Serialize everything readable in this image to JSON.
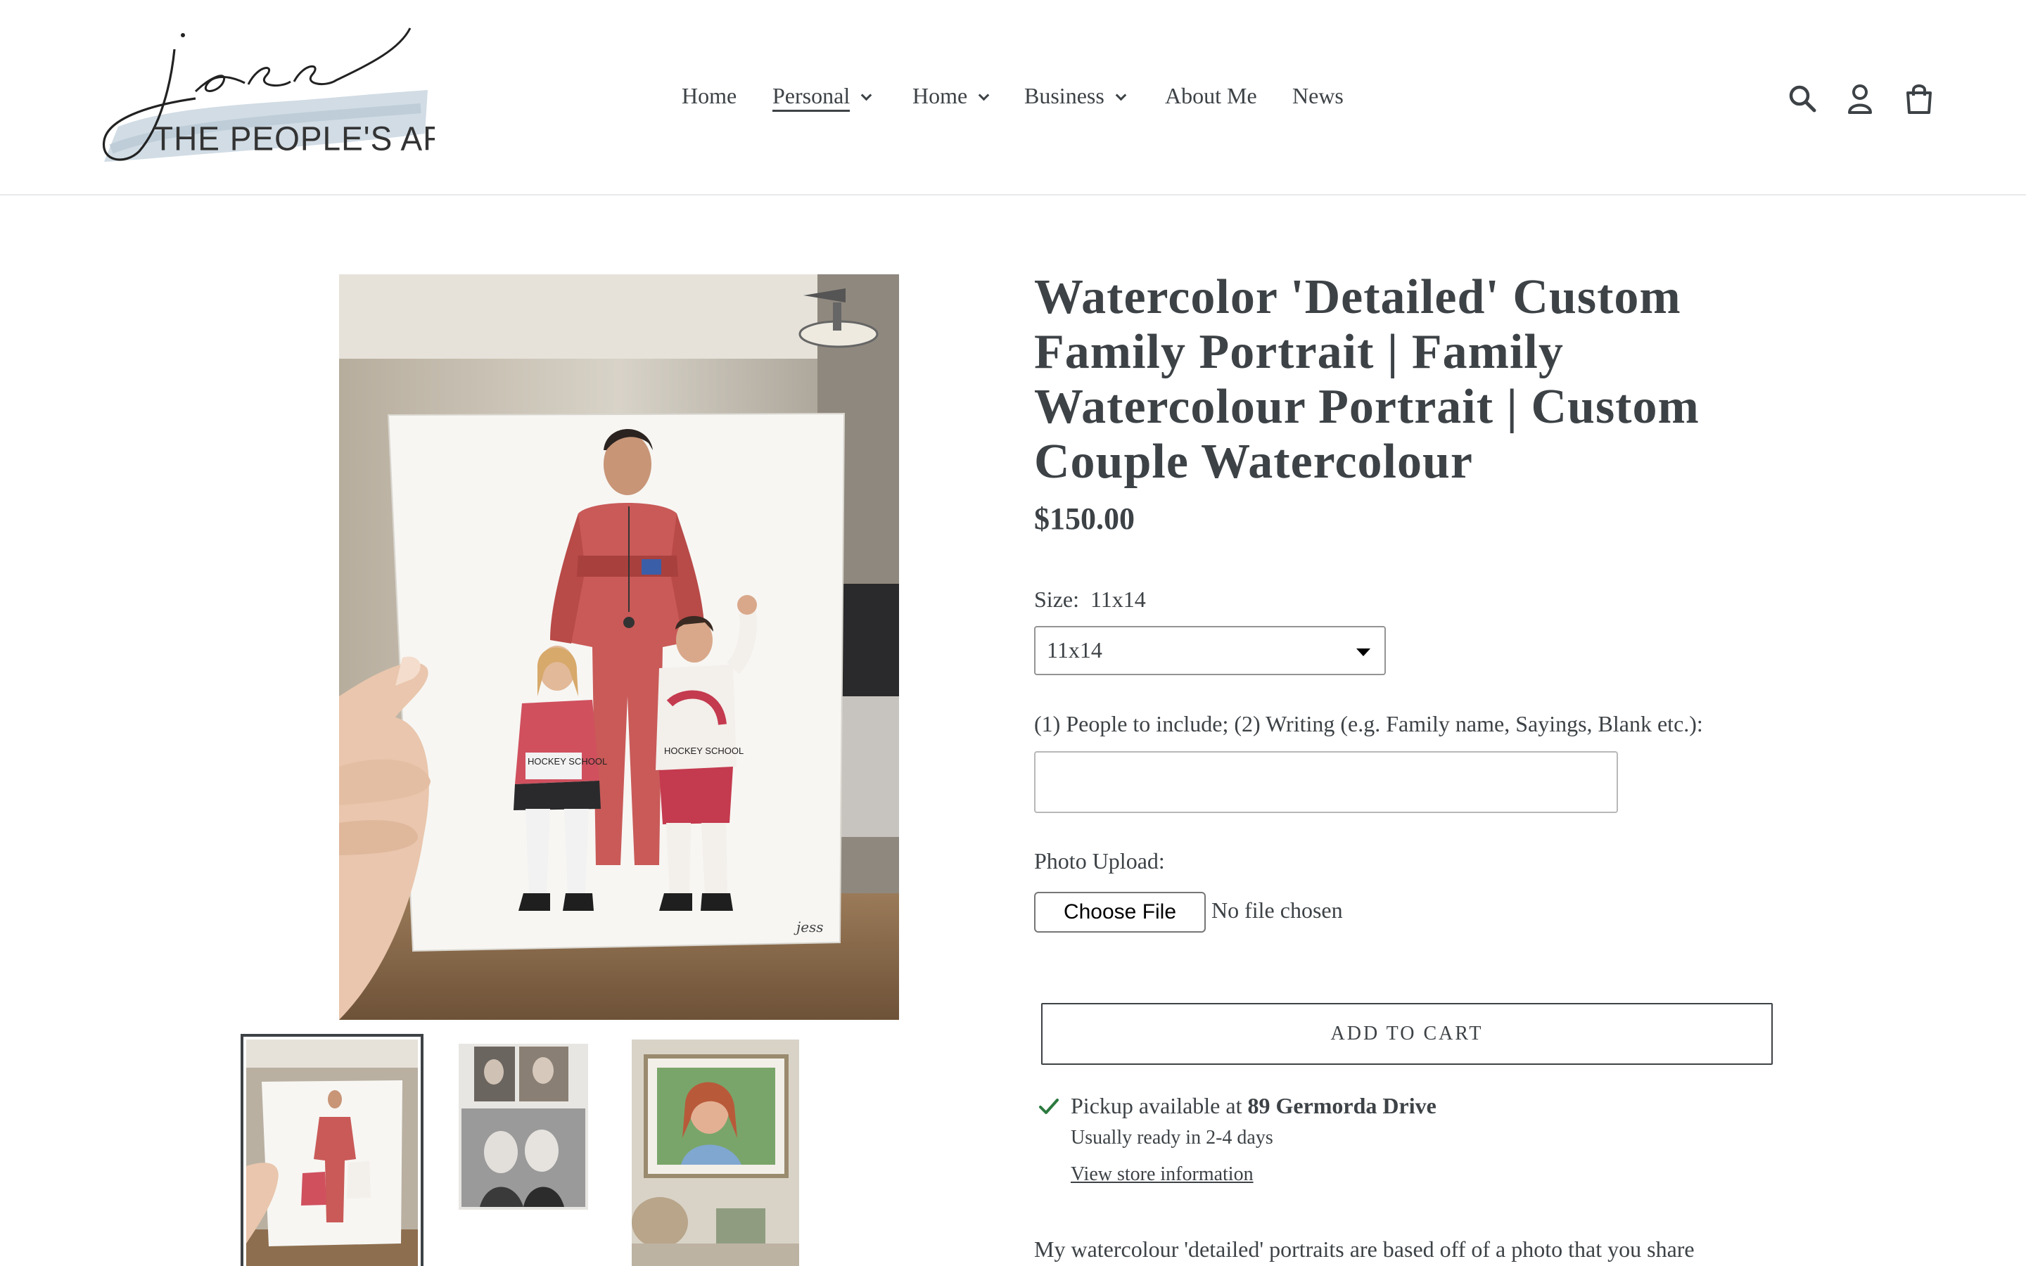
{
  "header": {
    "logo_script": "jess",
    "logo_tagline": "THE PEOPLE'S ARTIST",
    "nav": [
      {
        "label": "Home"
      },
      {
        "label": "Personal"
      },
      {
        "label": "Home"
      },
      {
        "label": "Business"
      },
      {
        "label": "About Me"
      },
      {
        "label": "News"
      }
    ],
    "icons": [
      "search-icon",
      "account-icon",
      "cart-icon"
    ]
  },
  "product": {
    "title": "Watercolor 'Detailed' Custom Family Portrait | Family Watercolour Portrait | Custom Couple Watercolour",
    "price": "$150.00",
    "size_label": "Size:",
    "size_value": "11x14",
    "size_selected": "11x14",
    "people_label": "(1) People to include; (2) Writing (e.g. Family name, Sayings, Blank etc.):",
    "people_value": "",
    "photo_label": "Photo Upload:",
    "file_button": "Choose File",
    "file_status": "No file chosen",
    "add_to_cart": "ADD TO CART",
    "pickup_prefix": "Pickup available at ",
    "pickup_location": "89 Germorda Drive",
    "pickup_ready": "Usually ready in 2-4 days",
    "store_info_link": "View store information",
    "description": "My watercolour 'detailed' portraits are based off of a photo that you share"
  },
  "sketch_text": {
    "jersey_1": "HOCKEY SCHOOL",
    "jersey_2": "HOCKEY SCHOOL",
    "signature": "jess"
  },
  "colors": {
    "text": "#3d4246",
    "check": "#2c7a3f",
    "logo_wash": "#c9d6e0"
  }
}
